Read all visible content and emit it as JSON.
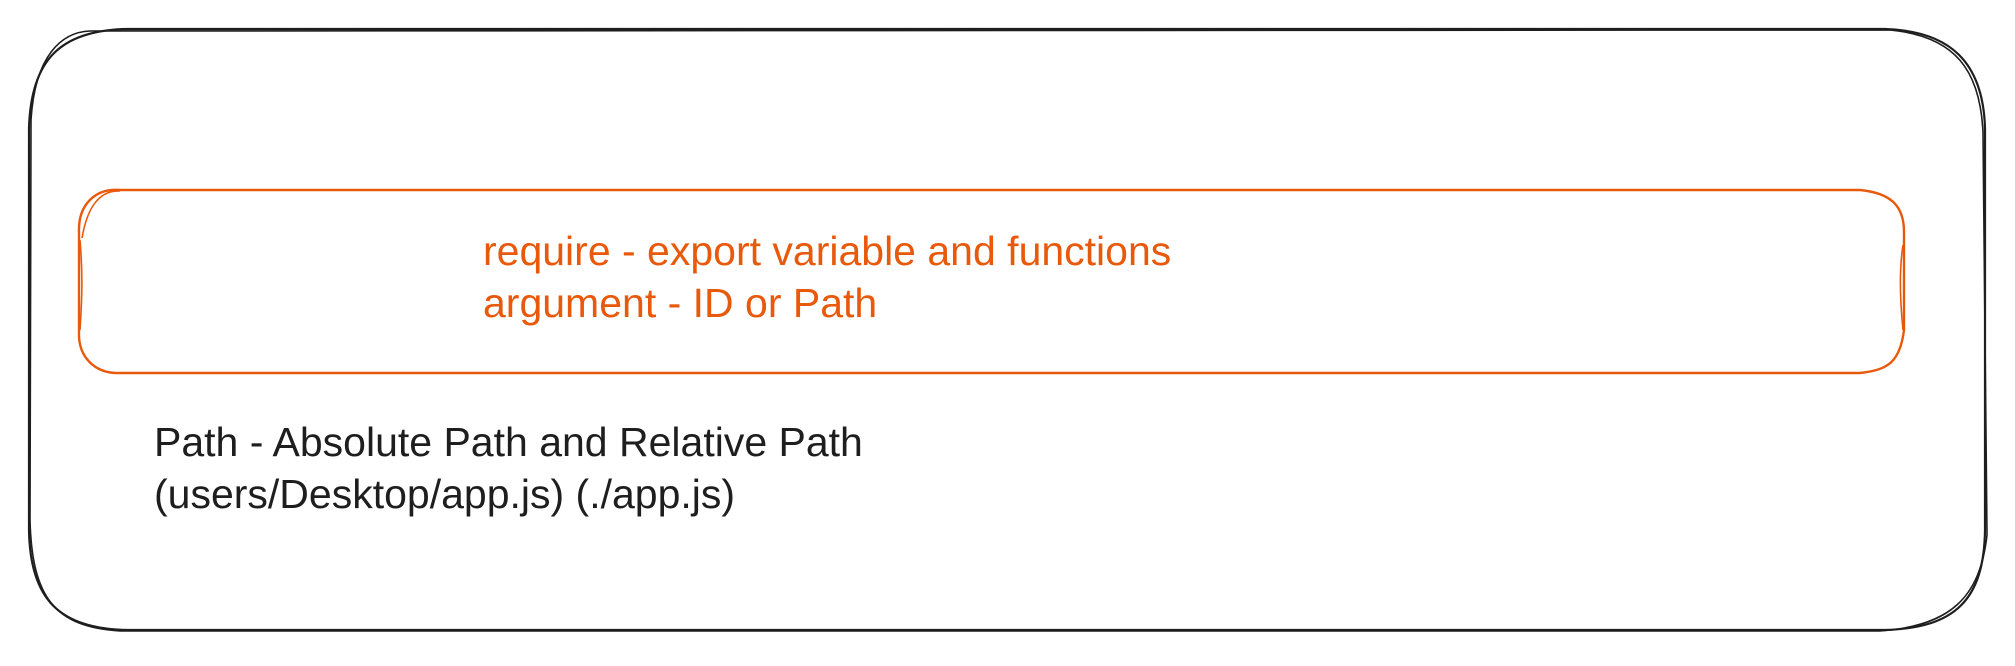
{
  "colors": {
    "outer_stroke": "#1e1e1e",
    "inner_stroke": "#e8590c",
    "inner_text": "#e8590c",
    "outer_text": "#1e1e1e"
  },
  "inner_box": {
    "lines": [
      "require - export variable and functions",
      "argument - ID or Path"
    ]
  },
  "outer_box": {
    "lines": [
      "Path - Absolute Path and Relative Path",
      "(users/Desktop/app.js) (./app.js)"
    ]
  }
}
